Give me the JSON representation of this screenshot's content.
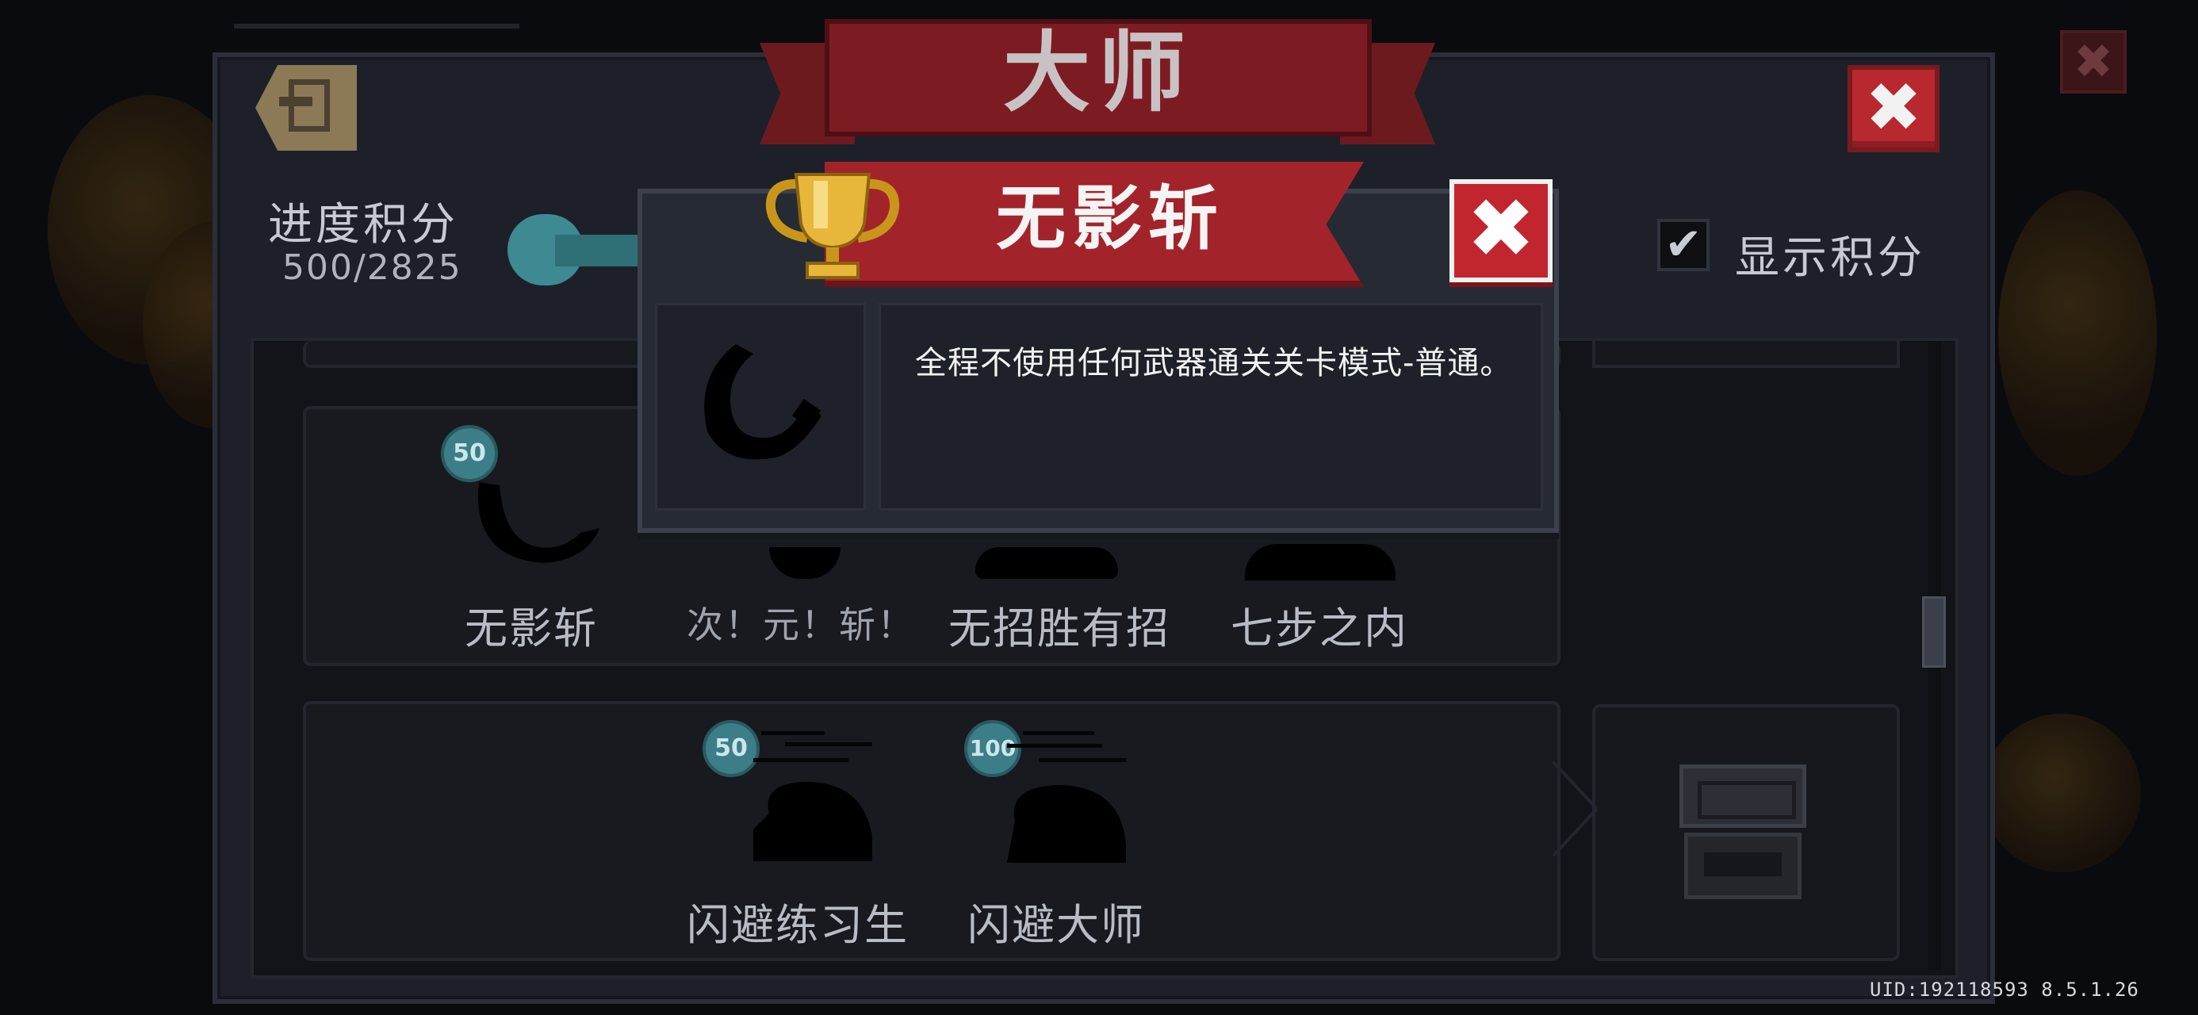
{
  "ribbon": {
    "title": "大师"
  },
  "header": {
    "progress_label": "进度积分",
    "progress_value": "500/2825",
    "show_score_check": "✔",
    "show_score_label": "显示积分",
    "close_label": "✖"
  },
  "achievements_row1": [
    {
      "label": "无影斩",
      "badge": "50"
    },
    {
      "label": "次！元！斩！"
    },
    {
      "label": "无招胜有招"
    },
    {
      "label": "七步之内"
    }
  ],
  "achievements_row2": [
    {
      "label": "闪避练习生",
      "badge": "50"
    },
    {
      "label": "闪避大师",
      "badge": "100"
    }
  ],
  "popup": {
    "title": "无影斩",
    "description": "全程不使用任何武器通关关卡模式-普通。",
    "close_label": "✖"
  },
  "footer": {
    "uid": "UID:192118593 8.5.1.26"
  },
  "icons": {
    "back": "exit-door-icon",
    "trophy": "trophy-icon",
    "chest": "treasure-chest-icon"
  },
  "colors": {
    "accent_red": "#b7282f",
    "badge_teal": "#3b7e88",
    "panel_bg": "#1d2028",
    "trophy_gold": "#e8b63a"
  }
}
